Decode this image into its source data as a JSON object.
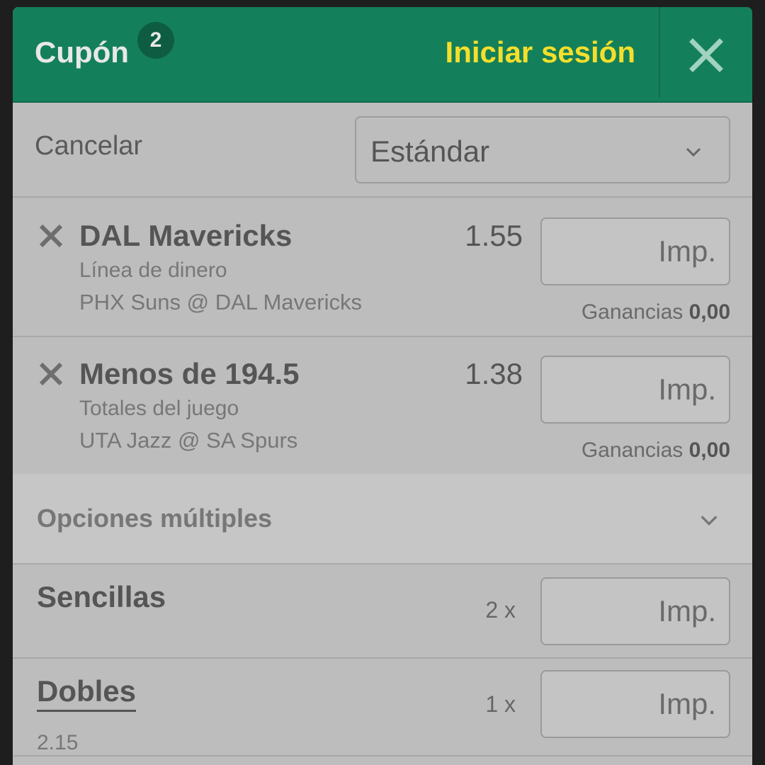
{
  "header": {
    "title": "Cupón",
    "badge_count": "2",
    "login_label": "Iniciar sesión"
  },
  "controls": {
    "cancel_label": "Cancelar",
    "bet_type_selected": "Estándar"
  },
  "bets": [
    {
      "selection": "DAL Mavericks",
      "market": "Línea de dinero",
      "event": "PHX Suns @ DAL Mavericks",
      "odds": "1.55",
      "stake_placeholder": "Imp.",
      "winnings_label": "Ganancias",
      "winnings_value": "0,00"
    },
    {
      "selection": "Menos de 194.5",
      "market": "Totales del juego",
      "event": "UTA Jazz @ SA Spurs",
      "odds": "1.38",
      "stake_placeholder": "Imp.",
      "winnings_label": "Ganancias",
      "winnings_value": "0,00"
    }
  ],
  "multiples": {
    "label": "Opciones múltiples",
    "rows": [
      {
        "name": "Sencillas",
        "count": "2 x",
        "stake_placeholder": "Imp.",
        "sub": ""
      },
      {
        "name": "Dobles",
        "count": "1 x",
        "stake_placeholder": "Imp.",
        "sub": "2.15"
      }
    ]
  },
  "colors": {
    "header_bg": "#14805b",
    "login_text": "#f5df2a",
    "panel_bg": "#bdbdbd"
  }
}
